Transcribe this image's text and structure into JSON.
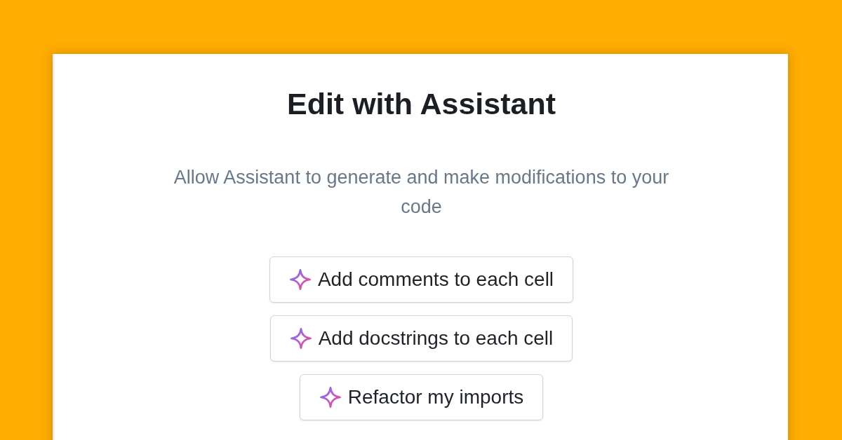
{
  "dialog": {
    "title": "Edit with Assistant",
    "description": "Allow Assistant to generate and make modifications to your code",
    "suggestions": [
      {
        "label": "Add comments to each cell"
      },
      {
        "label": "Add docstrings to each cell"
      },
      {
        "label": "Refactor my imports"
      }
    ]
  }
}
